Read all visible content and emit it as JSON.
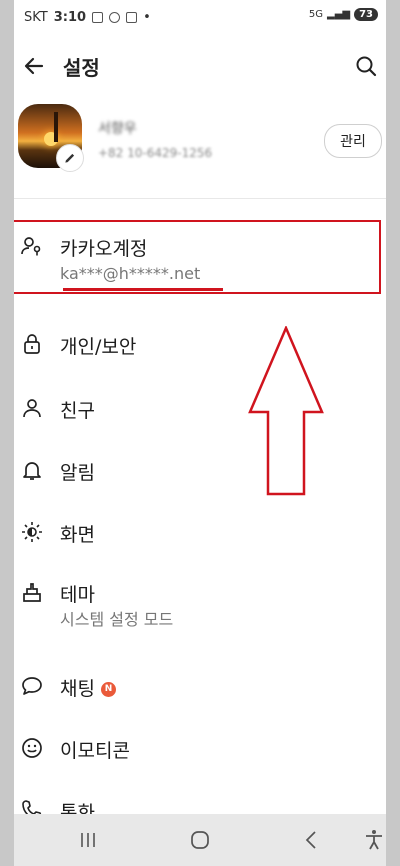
{
  "status_bar": {
    "carrier": "SKT",
    "time": "3:10",
    "network": "5G",
    "battery": "73"
  },
  "header": {
    "title": "설정",
    "back_icon": "arrow-left-icon",
    "search_icon": "search-icon"
  },
  "profile": {
    "name": "서향우",
    "phone": "+82 10-6429-1256",
    "manage_label": "관리",
    "edit_icon": "pencil-icon"
  },
  "menu": {
    "account": {
      "label": "카카오계정",
      "sub_masked": "ka***@h*****.n",
      "sub_suffix": "et",
      "icon": "person-key-icon"
    },
    "privacy": {
      "label": "개인/보안",
      "icon": "lock-icon"
    },
    "friends": {
      "label": "친구",
      "icon": "person-icon"
    },
    "alarm": {
      "label": "알림",
      "icon": "bell-icon"
    },
    "display": {
      "label": "화면",
      "icon": "brightness-icon"
    },
    "theme": {
      "label": "테마",
      "sub": "시스템 설정 모드",
      "icon": "brush-icon"
    },
    "chat": {
      "label": "채팅",
      "badge": "N",
      "icon": "chat-bubble-icon"
    },
    "emoticon": {
      "label": "이모티콘",
      "icon": "smiley-icon"
    },
    "call": {
      "label": "통화",
      "icon": "phone-icon"
    }
  },
  "annotation": {
    "color": "#d0141e"
  },
  "navbar": {
    "recent_icon": "recent-apps-icon",
    "home_icon": "home-icon",
    "back_icon": "back-icon",
    "accessibility_icon": "accessibility-icon"
  }
}
